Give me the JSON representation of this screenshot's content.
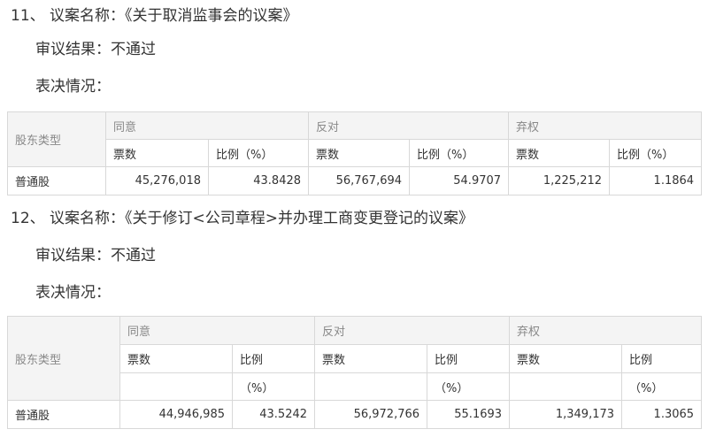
{
  "section1": {
    "title": "11、 议案名称：《关于取消监事会的议案》",
    "result": "审议结果：不通过",
    "voting": "表决情况：",
    "table": {
      "shareholder_type": "股东类型",
      "agree": "同意",
      "against": "反对",
      "abstain": "弃权",
      "votes": "票数",
      "ratio": "比例（%）",
      "row": {
        "type": "普通股",
        "agree_votes": "45,276,018",
        "agree_ratio": "43.8428",
        "against_votes": "56,767,694",
        "against_ratio": "54.9707",
        "abstain_votes": "1,225,212",
        "abstain_ratio": "1.1864"
      }
    }
  },
  "section2": {
    "title": "12、 议案名称：《关于修订<公司章程>并办理工商变更登记的议案》",
    "result": "审议结果：不通过",
    "voting": "表决情况：",
    "table": {
      "shareholder_type": "股东类型",
      "agree": "同意",
      "against": "反对",
      "abstain": "弃权",
      "votes": "票数",
      "ratio": "比例",
      "ratio_unit": "（%）",
      "row": {
        "type": "普通股",
        "agree_votes": "44,946,985",
        "agree_ratio": "43.5242",
        "against_votes": "56,972,766",
        "against_ratio": "55.1693",
        "abstain_votes": "1,349,173",
        "abstain_ratio": "1.3065"
      }
    }
  }
}
